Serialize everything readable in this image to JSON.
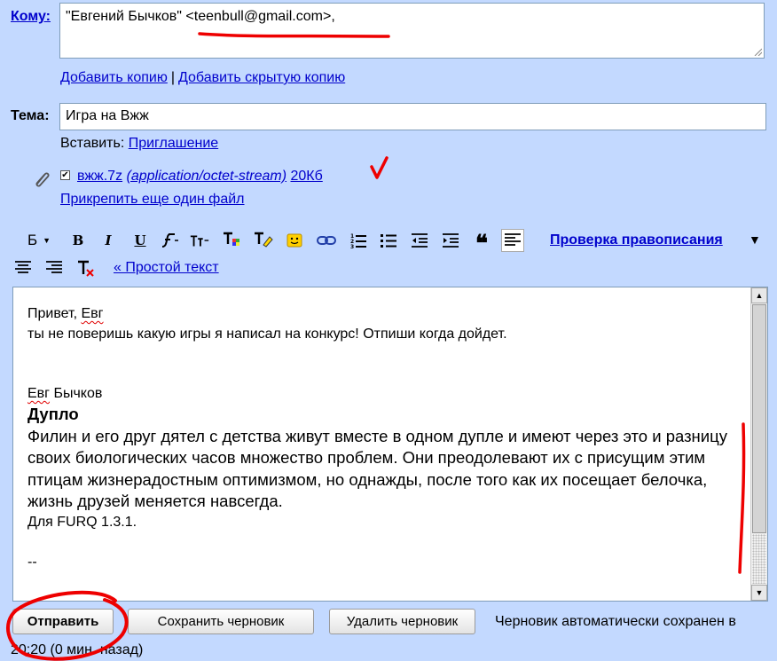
{
  "to": {
    "label": "Кому:",
    "value": "\"Евгений Бычков\" <teenbull@gmail.com>,",
    "add_cc": "Добавить копию",
    "separator": "|",
    "add_bcc": "Добавить скрытую копию"
  },
  "subject": {
    "label": "Тема:",
    "value": "Игра на Вжж"
  },
  "insert": {
    "label": "Вставить:",
    "invitation": "Приглашение"
  },
  "attachment": {
    "filename": "вжж.7z",
    "mime": "(application/octet-stream)",
    "size": "20Кб",
    "attach_another": "Прикрепить еще один файл",
    "checked": "✔"
  },
  "toolbar": {
    "font": "Б",
    "bold": "B",
    "italic": "I",
    "underline": "U",
    "spellcheck": "Проверка правописания",
    "spellcheck_arrow": "▼",
    "plain_text": "« Простой текст"
  },
  "body": {
    "greeting_prefix": "Привет, ",
    "greeting_name": "Евг",
    "line2": "ты не поверишь какую игры я написал на конкурс! Отпиши когда дойдет.",
    "sig_name_a": "Евг",
    "sig_name_b": " Бычков",
    "game_title": "Дупло",
    "description": "Филин и его друг дятел с детства живут вместе в одном дупле и имеют через это и разницу своих биологических часов множество проблем. Они преодолевают их с присущим этим птицам жизнерадостным оптимизмом, но однажды, после того как их посещает белочка, жизнь друзей меняется навсегда.",
    "engine": "Для FURQ 1.3.1.",
    "sig_sep": "--"
  },
  "actions": {
    "send": "Отправить",
    "save_draft": "Сохранить черновик",
    "delete_draft": "Удалить черновик",
    "status_line1": "Черновик автоматически сохранен в",
    "status_line2": "20:20 (0 мин. назад)"
  },
  "colors": {
    "background": "#c3d9ff",
    "link": "#0000cc",
    "annotation": "#ee0000"
  }
}
